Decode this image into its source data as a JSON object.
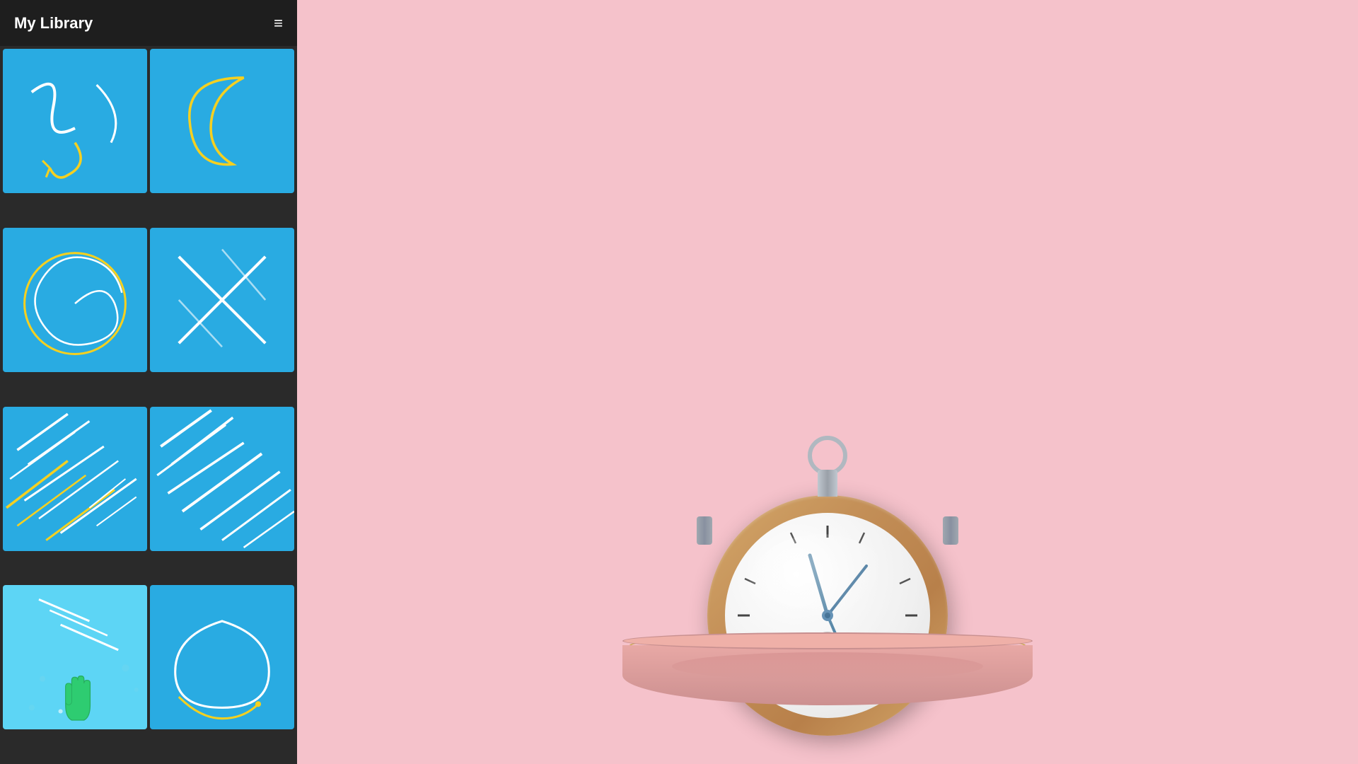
{
  "header": {
    "title": "My Library",
    "menu_icon": "≡"
  },
  "grid": {
    "items": [
      {
        "id": "item-1",
        "type": "curves-arrow",
        "selected": false
      },
      {
        "id": "item-2",
        "type": "crescent",
        "selected": false
      },
      {
        "id": "item-3",
        "type": "spiral-circle",
        "selected": false
      },
      {
        "id": "item-4",
        "type": "cross-lines",
        "selected": false
      },
      {
        "id": "item-5",
        "type": "diagonal-lines-yellow",
        "selected": false
      },
      {
        "id": "item-6",
        "type": "diagonal-lines-white",
        "selected": false
      },
      {
        "id": "item-7",
        "type": "selected-lines-cursor",
        "selected": true
      },
      {
        "id": "item-8",
        "type": "oval-line",
        "selected": false
      }
    ]
  },
  "main": {
    "background_color": "#f5c0cb",
    "content_type": "stopwatch"
  }
}
